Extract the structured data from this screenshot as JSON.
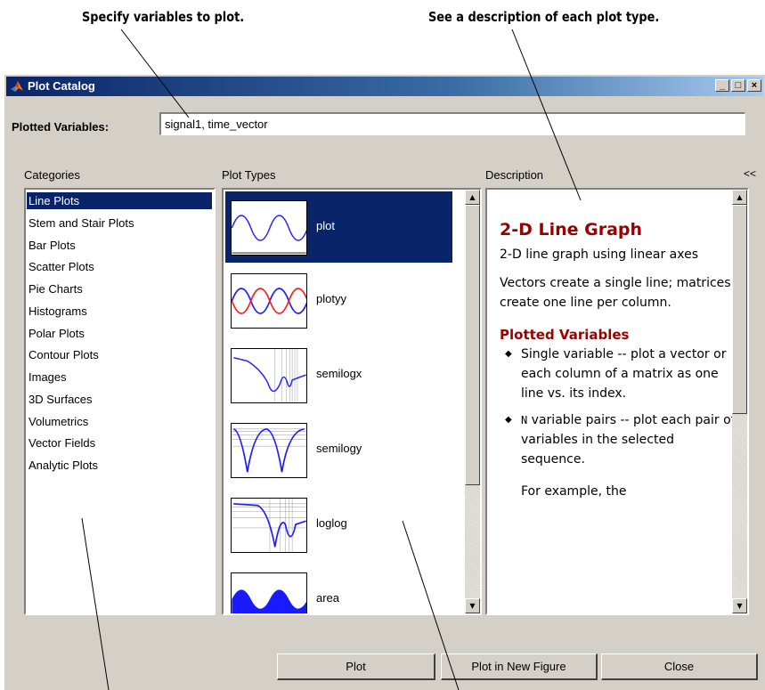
{
  "callouts": {
    "variables": "Specify variables to plot.",
    "description": "See a description of each plot type."
  },
  "window": {
    "title": "Plot Catalog",
    "controls": {
      "minimize": "_",
      "maximize": "□",
      "close": "×"
    }
  },
  "plotted_variables": {
    "label": "Plotted Variables:",
    "value": "signal1, time_vector"
  },
  "categories": {
    "label": "Categories",
    "items": [
      "Line Plots",
      "Stem and Stair Plots",
      "Bar Plots",
      "Scatter Plots",
      "Pie Charts",
      "Histograms",
      "Polar Plots",
      "Contour Plots",
      "Images",
      "3D Surfaces",
      "Volumetrics",
      "Vector Fields",
      "Analytic Plots"
    ],
    "selected": "Line Plots"
  },
  "plot_types": {
    "label": "Plot Types",
    "items": [
      "plot",
      "plotyy",
      "semilogx",
      "semilogy",
      "loglog",
      "area"
    ],
    "selected": "plot"
  },
  "description": {
    "label": "Description",
    "collapse": "<<",
    "title": "2-D Line Graph",
    "subtitle": "2-D line graph using linear axes",
    "body": "Vectors create a single line; matrices create one line per column.",
    "section_head": "Plotted Variables",
    "bullet1": "Single variable -- plot a vector or each column of a matrix as one line vs. its index.",
    "bullet2_code": "N",
    "bullet2": " variable pairs -- plot each pair of variables in the selected sequence.",
    "example": "For example, the"
  },
  "buttons": {
    "plot": "Plot",
    "plot_new": "Plot in New Figure",
    "close": "Close"
  },
  "colors": {
    "selection": "#0a246a",
    "desc_heading": "#990000",
    "face": "#d4d0c8",
    "series_blue": "#2020ff",
    "series_red": "#ff2020"
  }
}
